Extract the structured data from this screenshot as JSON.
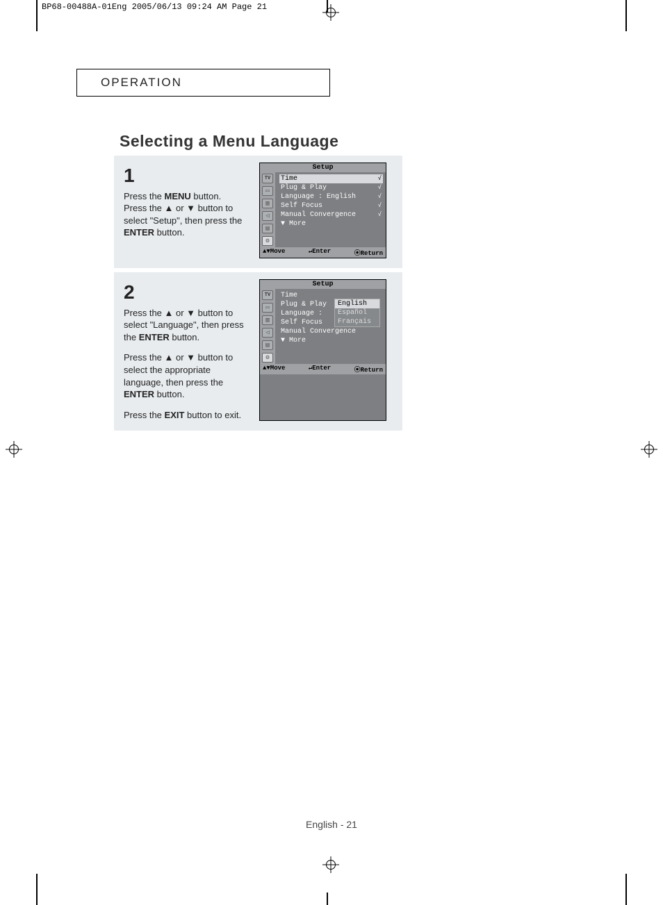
{
  "print": {
    "header": "BP68-00488A-01Eng  2005/06/13  09:24 AM  Page 21"
  },
  "section_header": "OPERATION",
  "page_title": "Selecting a Menu Language",
  "page_footer": "English - 21",
  "steps": [
    {
      "number": "1",
      "lines": [
        {
          "plain": "Press the ",
          "bold": "MENU",
          "tail": " button."
        },
        {
          "plain": "Press the ▲ or ▼ button to select \"Setup\", then press the ",
          "bold": "ENTER",
          "tail": " button."
        }
      ]
    },
    {
      "number": "2",
      "lines": [
        {
          "plain": "Press the ▲ or ▼ button to select \"Language\", then press the ",
          "bold": "ENTER",
          "tail": " button."
        },
        {
          "plain": "Press the ▲ or ▼ button to select the appropriate language, then press the ",
          "bold": "ENTER",
          "tail": " button."
        },
        {
          "plain": "Press the ",
          "bold": "EXIT",
          "tail": " button to exit."
        }
      ]
    }
  ],
  "osd1": {
    "title": "Setup",
    "icons_tv": "TV",
    "rows": [
      {
        "label": "Time",
        "value": "",
        "arrow": "√",
        "selected": true
      },
      {
        "label": "Plug & Play",
        "value": "",
        "arrow": "√"
      },
      {
        "label": "Language  :",
        "value": "English",
        "arrow": "√"
      },
      {
        "label": "Self Focus",
        "value": "",
        "arrow": "√"
      },
      {
        "label": "Manual Convergence",
        "value": "",
        "arrow": "√"
      },
      {
        "label": "▼  More",
        "value": "",
        "arrow": ""
      }
    ],
    "footer": {
      "move": "▲▼Move",
      "enter": "↵Enter",
      "ret": "⦿Return"
    }
  },
  "osd2": {
    "title": "Setup",
    "icons_tv": "TV",
    "rows": [
      {
        "label": "Time",
        "value": ""
      },
      {
        "label": "Plug & Play",
        "value": ""
      },
      {
        "label": "Language  :",
        "value": ""
      },
      {
        "label": "Self Focus",
        "value": ""
      },
      {
        "label": "Manual Convergence",
        "value": ""
      },
      {
        "label": "▼  More",
        "value": ""
      }
    ],
    "lang_options": [
      "English",
      "Español",
      "Français"
    ],
    "footer": {
      "move": "▲▼Move",
      "enter": "↵Enter",
      "ret": "⦿Return"
    }
  }
}
